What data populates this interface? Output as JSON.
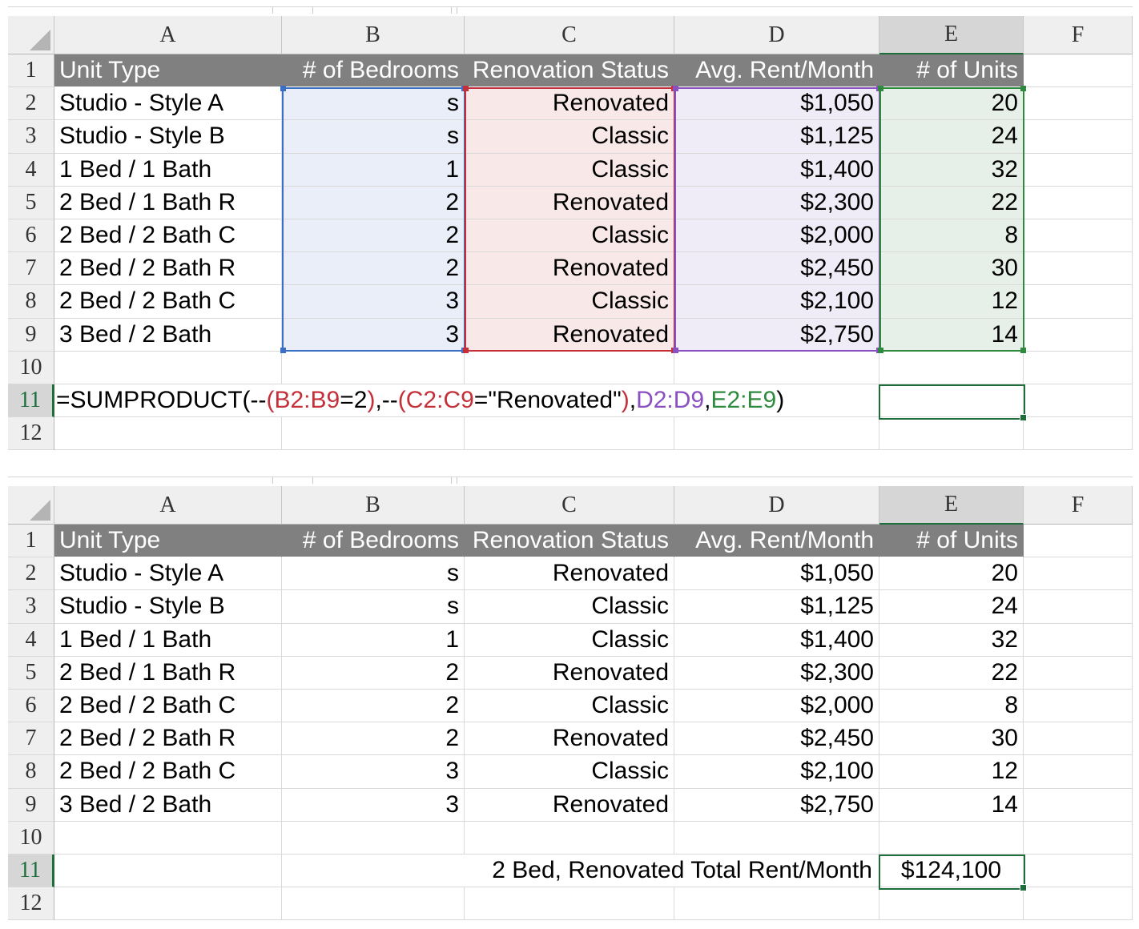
{
  "columns": [
    "A",
    "B",
    "C",
    "D",
    "E",
    "F"
  ],
  "rows": [
    "1",
    "2",
    "3",
    "4",
    "5",
    "6",
    "7",
    "8",
    "9",
    "10",
    "11",
    "12"
  ],
  "header": {
    "unit_type": "Unit Type",
    "bedrooms": "# of Bedrooms",
    "renovation": "Renovation Status",
    "rent": "Avg. Rent/Month",
    "units": "# of Units"
  },
  "table": [
    {
      "unit_type": "Studio - Style A",
      "bedrooms": "s",
      "renovation": "Renovated",
      "rent": "$1,050",
      "units": "20"
    },
    {
      "unit_type": "Studio - Style B",
      "bedrooms": "s",
      "renovation": "Classic",
      "rent": "$1,125",
      "units": "24"
    },
    {
      "unit_type": "1 Bed / 1 Bath",
      "bedrooms": "1",
      "renovation": "Classic",
      "rent": "$1,400",
      "units": "32"
    },
    {
      "unit_type": "2 Bed / 1 Bath R",
      "bedrooms": "2",
      "renovation": "Renovated",
      "rent": "$2,300",
      "units": "22"
    },
    {
      "unit_type": "2 Bed / 2 Bath C",
      "bedrooms": "2",
      "renovation": "Classic",
      "rent": "$2,000",
      "units": "8"
    },
    {
      "unit_type": "2 Bed / 2 Bath R",
      "bedrooms": "2",
      "renovation": "Renovated",
      "rent": "$2,450",
      "units": "30"
    },
    {
      "unit_type": "2 Bed / 2 Bath C",
      "bedrooms": "3",
      "renovation": "Classic",
      "rent": "$2,100",
      "units": "12"
    },
    {
      "unit_type": "3 Bed / 2 Bath",
      "bedrooms": "3",
      "renovation": "Renovated",
      "rent": "$2,750",
      "units": "14"
    }
  ],
  "formula": {
    "p1": "=SUMPRODUCT(--",
    "p2": "(B2:B9",
    "p3": "=2",
    "p4": ")",
    "p5": ",--",
    "p6": "(C2:C9",
    "p7": "=\"Renovated\"",
    "p8": ")",
    "p9": ",",
    "p10": "D2:D9",
    "p11": ",",
    "p12": "E2:E9",
    "p13": ")"
  },
  "result": {
    "label": "2 Bed, Renovated Total Rent/Month",
    "value": "$124,100"
  },
  "colors": {
    "range_b": "#3a6fc4",
    "range_c": "#c4303a",
    "range_d": "#8a4fc0",
    "range_e": "#2e8b3e",
    "header_fill": "#808080",
    "active_cell": "#1e6e3c"
  }
}
